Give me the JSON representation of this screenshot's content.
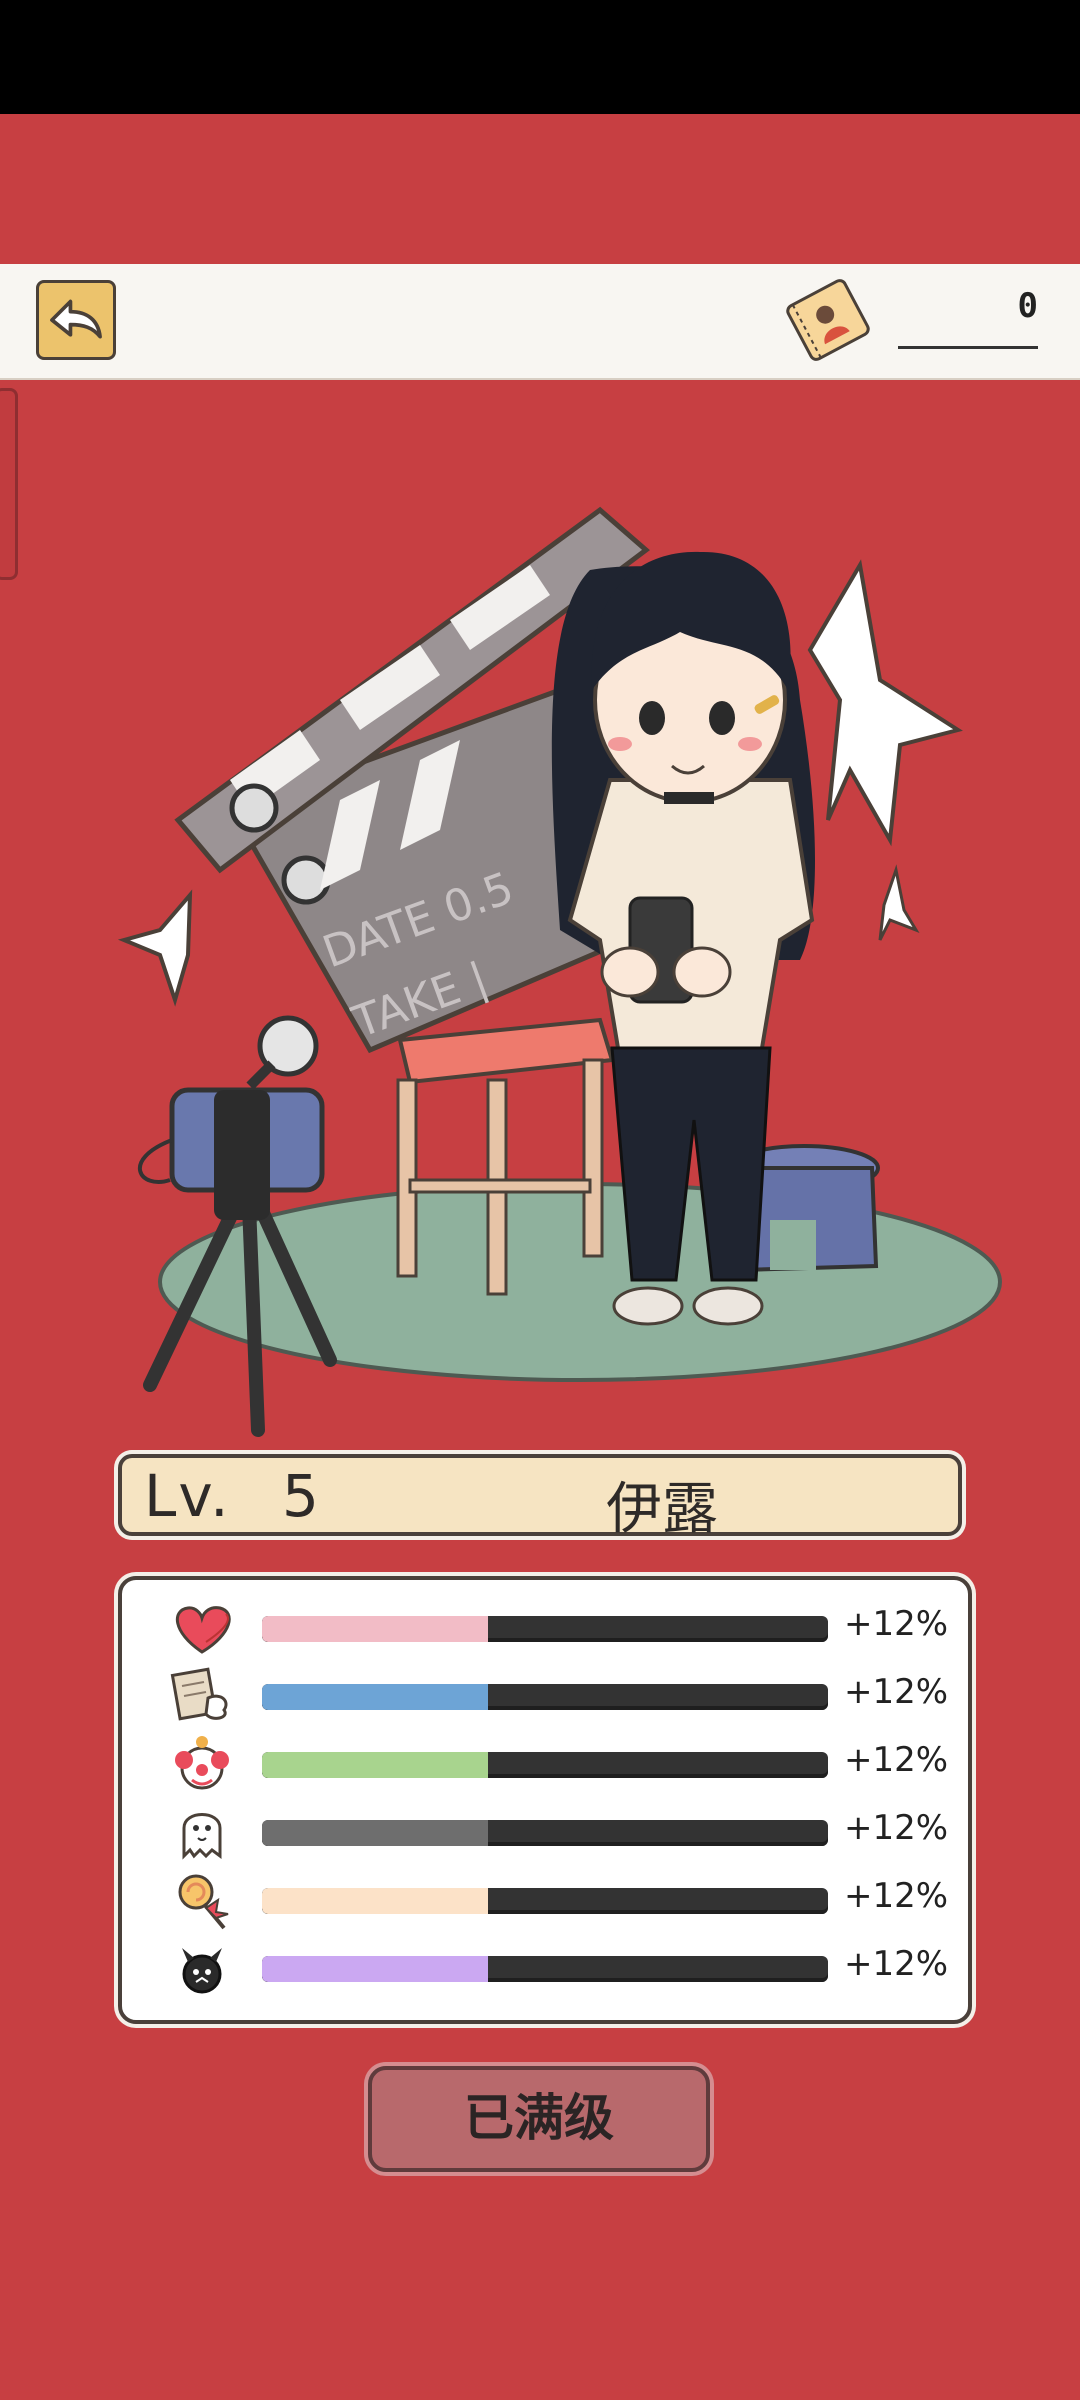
{
  "topbar": {
    "currency_value": "0",
    "back_icon": "back-arrow-icon",
    "currency_icon": "ticket-icon"
  },
  "character": {
    "level_label": "Lv.",
    "level_value": "5",
    "name": "伊露"
  },
  "stats": [
    {
      "icon": "heart-icon",
      "color": "#f2bcc6",
      "fill_fraction": 0.4,
      "bonus": "+12%"
    },
    {
      "icon": "paper-tissue-icon",
      "color": "#6da4d6",
      "fill_fraction": 0.4,
      "bonus": "+12%"
    },
    {
      "icon": "clown-icon",
      "color": "#a8d48e",
      "fill_fraction": 0.4,
      "bonus": "+12%"
    },
    {
      "icon": "ghost-icon",
      "color": "#6e6e6e",
      "fill_fraction": 0.4,
      "bonus": "+12%"
    },
    {
      "icon": "lollipop-icon",
      "color": "#fce2c8",
      "fill_fraction": 0.4,
      "bonus": "+12%"
    },
    {
      "icon": "devil-icon",
      "color": "#cba8f2",
      "fill_fraction": 0.4,
      "bonus": "+12%"
    }
  ],
  "max_button": {
    "label": "已满级"
  },
  "scene": {
    "clapper_text_1": "DATE 0.5",
    "clapper_text_2": "TAKE |"
  }
}
